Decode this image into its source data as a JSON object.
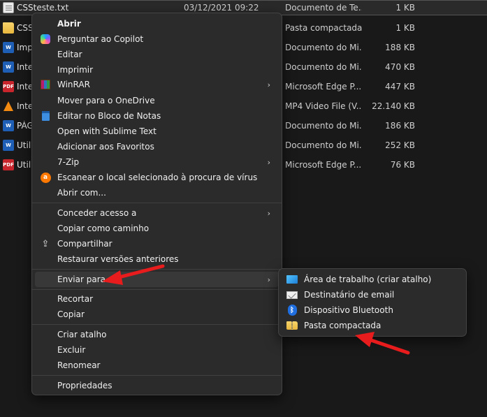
{
  "files": [
    {
      "name": "CSSteste.txt",
      "date": "03/12/2021 09:22",
      "type": "Documento de Te...",
      "size": "1 KB",
      "icon": "text-file-icon",
      "selected": true
    },
    {
      "name": "CSS",
      "date": "",
      "type": "Pasta compactada",
      "size": "1 KB",
      "icon": "zip-folder-icon"
    },
    {
      "name": "Imp",
      "date": "",
      "type": "Documento do Mi...",
      "size": "188 KB",
      "icon": "word-document-icon"
    },
    {
      "name": "Inte",
      "date": "",
      "type": "Documento do Mi...",
      "size": "470 KB",
      "icon": "word-document-icon"
    },
    {
      "name": "Inte",
      "date": "",
      "type": "Microsoft Edge P...",
      "size": "447 KB",
      "icon": "pdf-icon"
    },
    {
      "name": "Inte",
      "date": "",
      "type": "MP4 Video File (V...",
      "size": "22.140 KB",
      "icon": "vlc-icon"
    },
    {
      "name": "PÁG",
      "date": "",
      "type": "Documento do Mi...",
      "size": "186 KB",
      "icon": "word-document-icon"
    },
    {
      "name": "Utili",
      "date": "",
      "type": "Documento do Mi...",
      "size": "252 KB",
      "icon": "word-document-icon"
    },
    {
      "name": "Utili",
      "date": "",
      "type": "Microsoft Edge P...",
      "size": "76 KB",
      "icon": "pdf-icon"
    }
  ],
  "icon_labels": {
    "word": "W",
    "pdf": "PDF"
  },
  "menu": {
    "abrir": "Abrir",
    "copilot": "Perguntar ao Copilot",
    "editar": "Editar",
    "imprimir": "Imprimir",
    "winrar": "WinRAR",
    "onedrive": "Mover para o OneDrive",
    "notepad": "Editar no Bloco de Notas",
    "sublime": "Open with Sublime Text",
    "favoritos": "Adicionar aos Favoritos",
    "zip7": "7-Zip",
    "avast": "Escanear o local selecionado à procura de vírus",
    "abrir_com": "Abrir com...",
    "conceder": "Conceder acesso a",
    "copiar_caminho": "Copiar como caminho",
    "compartilhar": "Compartilhar",
    "restaurar": "Restaurar versões anteriores",
    "enviar": "Enviar para",
    "recortar": "Recortar",
    "copiar": "Copiar",
    "criar_atalho": "Criar atalho",
    "excluir": "Excluir",
    "renomear": "Renomear",
    "propriedades": "Propriedades",
    "chevron": "›"
  },
  "submenu": {
    "desktop": "Área de trabalho (criar atalho)",
    "mail": "Destinatário de email",
    "bluetooth": "Dispositivo Bluetooth",
    "zip": "Pasta compactada",
    "bt_glyph": "ᛒ"
  },
  "colors": {
    "arrow": "#e81c1c",
    "menu_bg": "#2b2b2b",
    "background": "#191919"
  }
}
